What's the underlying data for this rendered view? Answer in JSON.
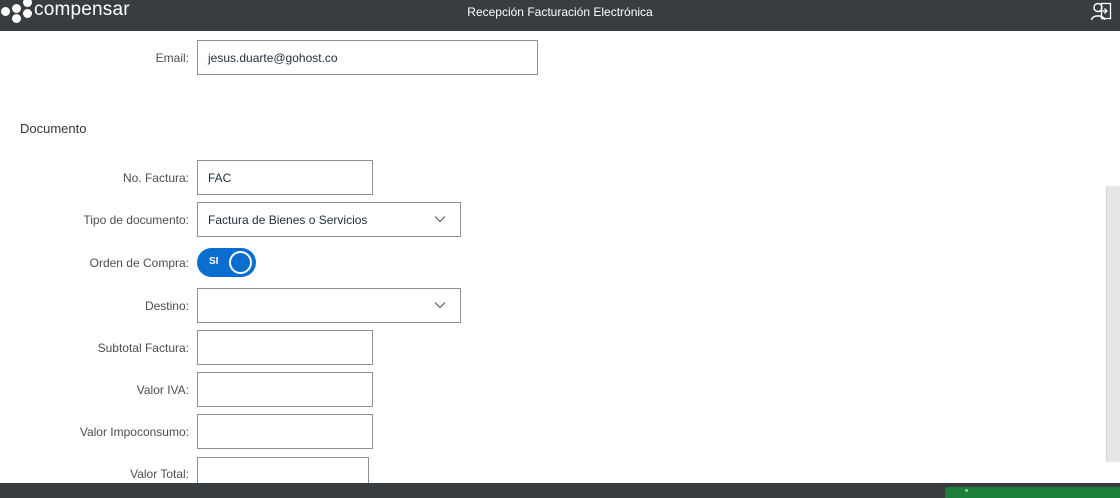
{
  "header": {
    "brand": "compensar",
    "title": "Recepción Facturación Electrónica",
    "logout_icon": "user-logout-icon"
  },
  "contact": {
    "email_label": "Email:",
    "email_value": "jesus.duarte@gohost.co"
  },
  "documento": {
    "section_title": "Documento",
    "no_factura_label": "No. Factura:",
    "no_factura_value": "FAC",
    "tipo_label": "Tipo de documento:",
    "tipo_value": "Factura de Bienes o Servicios",
    "orden_label": "Orden de Compra:",
    "orden_toggle_text": "SI",
    "orden_toggle_on": true,
    "destino_label": "Destino:",
    "destino_value": "",
    "subtotal_label": "Subtotal Factura:",
    "subtotal_value": "",
    "iva_label": "Valor IVA:",
    "iva_value": "",
    "impoconsumo_label": "Valor Impoconsumo:",
    "impoconsumo_value": "",
    "total_label": "Valor Total:",
    "total_value": ""
  },
  "colors": {
    "header_bg": "#3a3d40",
    "accent": "#0a6ed1",
    "footer_action": "#1b7f3a"
  }
}
